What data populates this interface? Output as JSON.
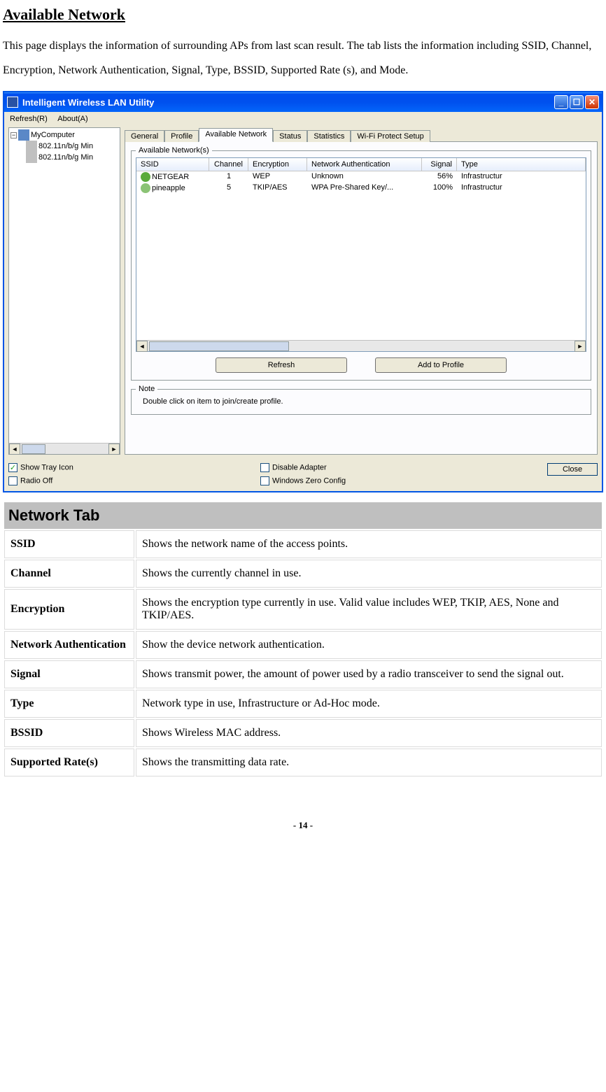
{
  "page": {
    "title": "Available Network",
    "intro": "This page displays the information of surrounding APs from last scan result. The tab lists the information including SSID, Channel, Encryption, Network Authentication, Signal, Type, BSSID, Supported Rate (s), and Mode."
  },
  "window": {
    "title": "Intelligent Wireless LAN Utility",
    "menu": {
      "refresh": "Refresh(R)",
      "about": "About(A)"
    },
    "tree": {
      "root": "MyComputer",
      "items": [
        "802.11n/b/g Min",
        "802.11n/b/g Min"
      ]
    },
    "tabs": [
      "General",
      "Profile",
      "Available Network",
      "Status",
      "Statistics",
      "Wi-Fi Protect Setup"
    ],
    "active_tab": "Available Network",
    "fieldset_label": "Available Network(s)",
    "columns": {
      "ssid": "SSID",
      "channel": "Channel",
      "encryption": "Encryption",
      "auth": "Network Authentication",
      "signal": "Signal",
      "type": "Type"
    },
    "rows": [
      {
        "ssid": "NETGEAR",
        "channel": "1",
        "encryption": "WEP",
        "auth": "Unknown",
        "signal": "56%",
        "type": "Infrastructur"
      },
      {
        "ssid": "pineapple",
        "channel": "5",
        "encryption": "TKIP/AES",
        "auth": "WPA Pre-Shared Key/...",
        "signal": "100%",
        "type": "Infrastructur"
      }
    ],
    "buttons": {
      "refresh": "Refresh",
      "add": "Add to Profile"
    },
    "note_label": "Note",
    "note_text": "Double click on item to join/create profile.",
    "checkboxes": {
      "show_tray": {
        "label": "Show Tray Icon",
        "checked": true
      },
      "radio_off": {
        "label": "Radio Off",
        "checked": false
      },
      "disable_adapter": {
        "label": "Disable Adapter",
        "checked": false
      },
      "wzc": {
        "label": "Windows Zero Config",
        "checked": false
      }
    },
    "close": "Close"
  },
  "desc": {
    "header": "Network Tab",
    "rows": [
      {
        "k": "SSID",
        "v": "Shows the network name of the access points."
      },
      {
        "k": "Channel",
        "v": "Shows the currently channel in use."
      },
      {
        "k": "Encryption",
        "v": "Shows the encryption type currently in use. Valid value includes WEP, TKIP, AES, None and TKIP/AES."
      },
      {
        "k": "Network Authentication",
        "v": "Show the device network authentication."
      },
      {
        "k": "Signal",
        "v": "Shows transmit power, the amount of power used by a radio transceiver to send the signal out."
      },
      {
        "k": "Type",
        "v": "Network type in use, Infrastructure or Ad-Hoc mode."
      },
      {
        "k": "BSSID",
        "v": "Shows Wireless MAC address."
      },
      {
        "k": "Supported Rate(s)",
        "v": "Shows the transmitting data rate."
      }
    ]
  },
  "footer": "- 14 -"
}
